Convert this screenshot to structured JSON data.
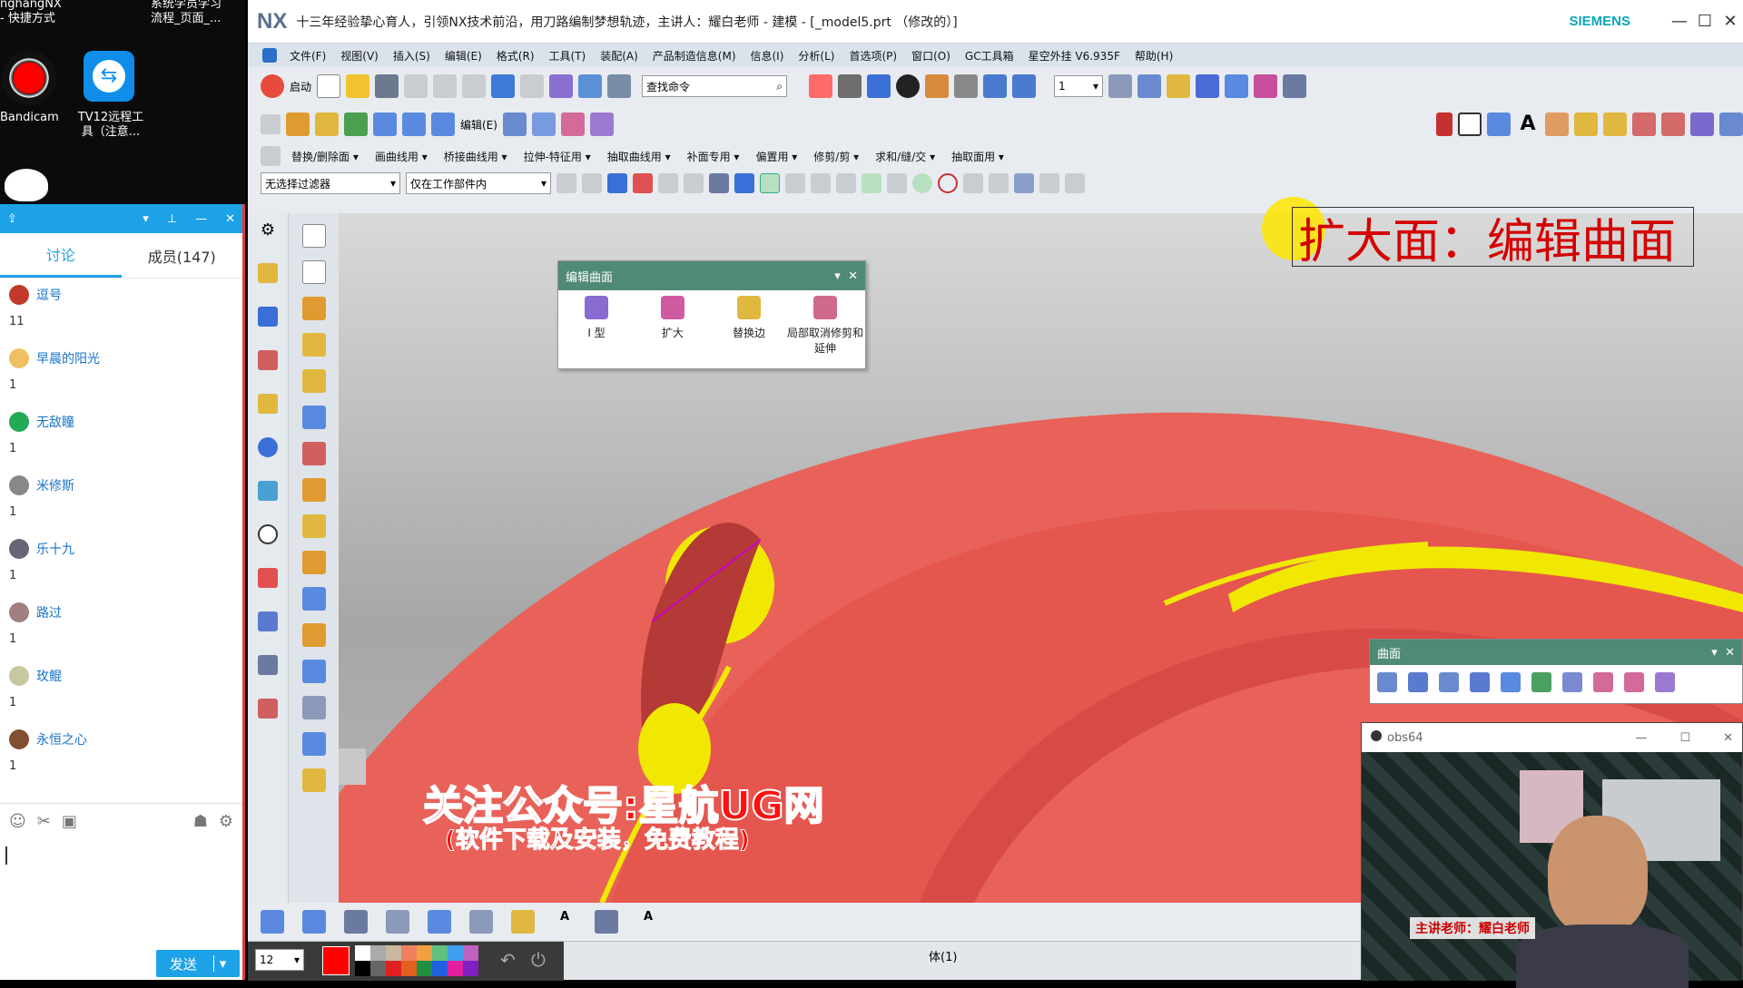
{
  "desktop": {
    "top_left_line1": "nghangNX",
    "top_left_line2": "- 快捷方式",
    "top_mid_line1": "系统学员学习",
    "top_mid_line2": "流程_页面_...",
    "bandicam_label": "Bandicam",
    "teamviewer_label": "TV12远程工具（注意..."
  },
  "chat": {
    "tabs": [
      "讨论",
      "成员(147)"
    ],
    "members": [
      {
        "name": "逗号",
        "count": "11"
      },
      {
        "name": "早晨的阳光",
        "count": "1"
      },
      {
        "name": "无敌瞳",
        "count": "1"
      },
      {
        "name": "米修斯",
        "count": "1"
      },
      {
        "name": "乐十九",
        "count": "1"
      },
      {
        "name": "路过",
        "count": "1"
      },
      {
        "name": "玫鲲",
        "count": "1"
      },
      {
        "name": "永恒之心",
        "count": "1"
      }
    ],
    "send_label": "发送"
  },
  "nx": {
    "logo": "NX",
    "title": "十三年经验挚心育人，引领NX技术前沿，用刀路编制梦想轨迹，主讲人：耀白老师 - 建模 - [_model5.prt （修改的）]",
    "brand": "SIEMENS",
    "menus": [
      "文件(F)",
      "视图(V)",
      "插入(S)",
      "编辑(E)",
      "格式(R)",
      "工具(T)",
      "装配(A)",
      "产品制造信息(M)",
      "信息(I)",
      "分析(L)",
      "首选项(P)",
      "窗口(O)",
      "GC工具箱",
      "星空外挂 V6.935F",
      "帮助(H)"
    ],
    "start_label": "启动",
    "search_placeholder": "查找命令",
    "edit_label": "编辑(E)",
    "layer_value": "1",
    "toolbar3": [
      "替换/删除面 ▾",
      "画曲线用 ▾",
      "桥接曲线用 ▾",
      "拉伸-特征用 ▾",
      "抽取曲线用 ▾",
      "补面专用 ▾",
      "偏置用 ▾",
      "修剪/剪 ▾",
      "求和/缝/交 ▾",
      "抽取面用 ▾"
    ],
    "filter_value": "无选择过滤器",
    "scope_value": "仅在工作部件内",
    "edit_surface_panel": {
      "title": "编辑曲面",
      "buttons": [
        "I 型",
        "扩大",
        "替换边",
        "局部取消修剪和延伸"
      ]
    },
    "annotation": "扩大面：编辑曲面",
    "watermark_line1": "关注公众号:星航UG网",
    "watermark_line2": "(软件下载及安装，免费教程)",
    "surface_panel_title": "曲面",
    "status_center": "体(1)",
    "font_size_value": "12",
    "obs_title": "obs64",
    "teacher_caption": "主讲老师：耀白老师"
  },
  "colors": {
    "model_red": "#e8625a",
    "highlight_yellow": "#f0e800",
    "panel_header": "#4f8a76",
    "qq_blue": "#1da2e8",
    "annotation_red": "#d40000"
  }
}
